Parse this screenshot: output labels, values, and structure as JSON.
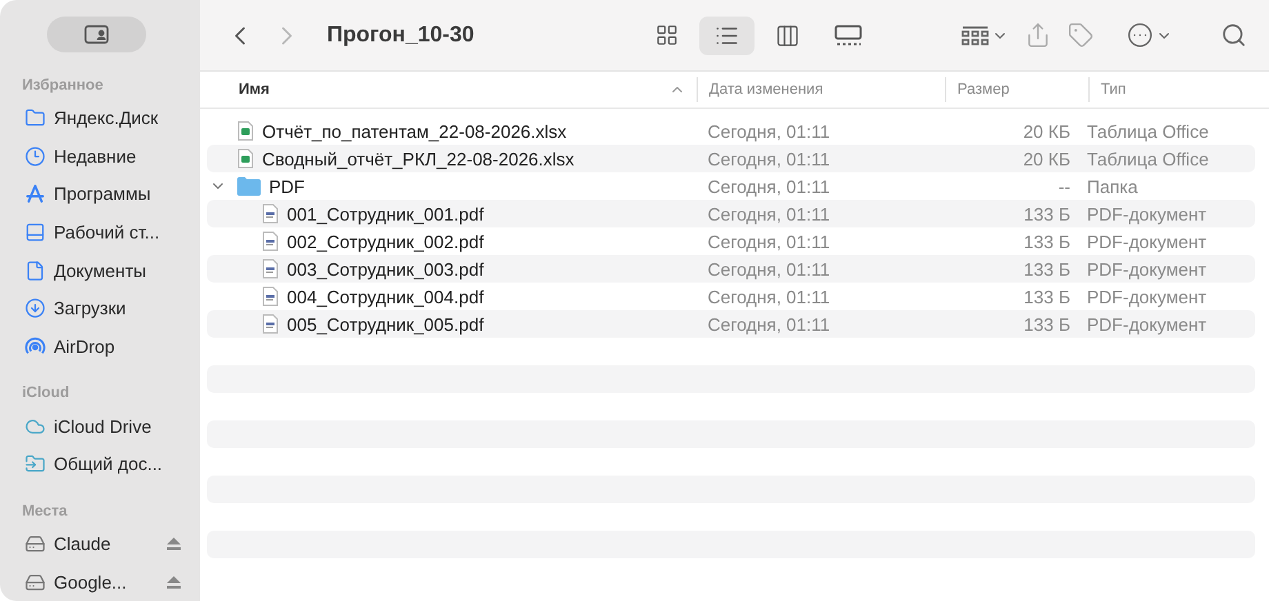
{
  "sidebar": {
    "sections": [
      {
        "title": "Избранное",
        "items": [
          {
            "label": "Яндекс.Диск",
            "kind": "folder",
            "eject": false
          },
          {
            "label": "Недавние",
            "kind": "clock",
            "eject": false
          },
          {
            "label": "Программы",
            "kind": "apps",
            "eject": false
          },
          {
            "label": "Рабочий ст...",
            "kind": "desktop",
            "eject": false
          },
          {
            "label": "Документы",
            "kind": "document",
            "eject": false
          },
          {
            "label": "Загрузки",
            "kind": "download",
            "eject": false
          },
          {
            "label": "AirDrop",
            "kind": "airdrop",
            "eject": false
          }
        ]
      },
      {
        "title": "iCloud",
        "items": [
          {
            "label": "iCloud Drive",
            "kind": "cloud",
            "eject": false
          },
          {
            "label": "Общий дос...",
            "kind": "shared",
            "eject": false
          }
        ]
      },
      {
        "title": "Места",
        "items": [
          {
            "label": "Claude",
            "kind": "drive",
            "eject": true
          },
          {
            "label": "Google...",
            "kind": "drive",
            "eject": true
          }
        ]
      }
    ]
  },
  "toolbar": {
    "nav": [
      {
        "kind": "back",
        "disabled": false
      },
      {
        "kind": "forward",
        "disabled": true
      }
    ],
    "title": "Прогон_10-30",
    "views": [
      {
        "kind": "icons",
        "selected": false
      },
      {
        "kind": "list",
        "selected": true
      },
      {
        "kind": "columns",
        "selected": false
      },
      {
        "kind": "gallery",
        "selected": false
      }
    ]
  },
  "table": {
    "columns": [
      {
        "label": "Имя",
        "sorted": true
      },
      {
        "label": "Дата изменения",
        "sorted": false
      },
      {
        "label": "Размер",
        "sorted": false
      },
      {
        "label": "Тип",
        "sorted": false
      }
    ],
    "rows": [
      {
        "kind": "xlsx",
        "name": "Отчёт_по_патентам_22-08-2026.xlsx",
        "date": "Сегодня, 01:11",
        "size": "20 КБ",
        "type": "Таблица Office"
      },
      {
        "kind": "xlsx",
        "name": "Сводный_отчёт_РКЛ_22-08-2026.xlsx",
        "date": "Сегодня, 01:11",
        "size": "20 КБ",
        "type": "Таблица Office"
      },
      {
        "kind": "folder",
        "name": "PDF",
        "date": "Сегодня, 01:11",
        "size": "--",
        "type": "Папка",
        "expanded": true,
        "children": [
          {
            "kind": "pdf",
            "name": "001_Сотрудник_001.pdf",
            "date": "Сегодня, 01:11",
            "size": "133 Б",
            "type": "PDF-документ"
          },
          {
            "kind": "pdf",
            "name": "002_Сотрудник_002.pdf",
            "date": "Сегодня, 01:11",
            "size": "133 Б",
            "type": "PDF-документ"
          },
          {
            "kind": "pdf",
            "name": "003_Сотрудник_003.pdf",
            "date": "Сегодня, 01:11",
            "size": "133 Б",
            "type": "PDF-документ"
          },
          {
            "kind": "pdf",
            "name": "004_Сотрудник_004.pdf",
            "date": "Сегодня, 01:11",
            "size": "133 Б",
            "type": "PDF-документ"
          },
          {
            "kind": "pdf",
            "name": "005_Сотрудник_005.pdf",
            "date": "Сегодня, 01:11",
            "size": "133 Б",
            "type": "PDF-документ"
          }
        ]
      }
    ]
  }
}
